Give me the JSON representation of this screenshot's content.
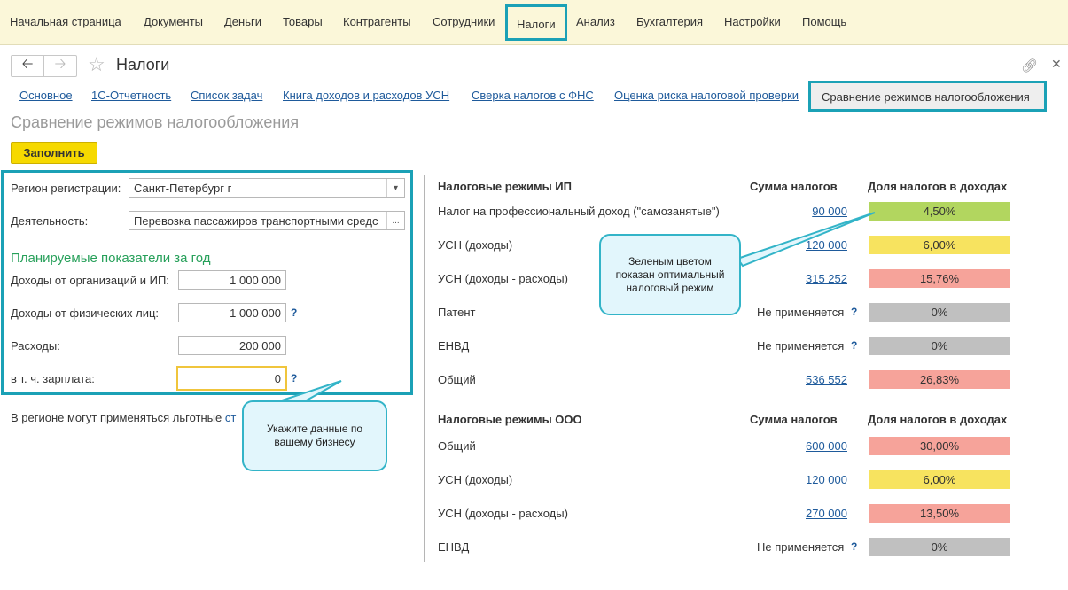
{
  "menu": {
    "items": [
      {
        "label": "Начальная страница"
      },
      {
        "label": "Документы"
      },
      {
        "label": "Деньги"
      },
      {
        "label": "Товары"
      },
      {
        "label": "Контрагенты"
      },
      {
        "label": "Сотрудники"
      },
      {
        "label": "Налоги"
      },
      {
        "label": "Анализ"
      },
      {
        "label": "Бухгалтерия"
      },
      {
        "label": "Настройки"
      },
      {
        "label": "Помощь"
      }
    ],
    "active": "Налоги"
  },
  "titlebar": {
    "back_icon": "arrow-left-icon",
    "forward_icon": "arrow-right-icon",
    "favorite_icon": "star-icon",
    "title": "Налоги",
    "link_icon": "link-icon",
    "close_icon": "close-icon"
  },
  "tabs": [
    {
      "label": "Основное"
    },
    {
      "label": "1С-Отчетность"
    },
    {
      "label": "Список задач"
    },
    {
      "label": "Книга доходов и расходов УСН"
    },
    {
      "label": "Сверка налогов с ФНС"
    },
    {
      "label": "Оценка риска налоговой проверки"
    },
    {
      "label": "Сравнение режимов налогообложения"
    }
  ],
  "section_title": "Сравнение режимов налогообложения",
  "fill_button": "Заполнить",
  "form": {
    "region_label": "Регион регистрации:",
    "region_value": "Санкт-Петербург г",
    "activity_label": "Деятельность:",
    "activity_value": "Перевозка пассажиров транспортными средс",
    "activity_button": "...",
    "group_title": "Планируемые показатели за год",
    "income_org_label": "Доходы от организаций и ИП:",
    "income_org_value": "1 000 000",
    "income_person_label": "Доходы от физических лиц:",
    "income_person_value": "1 000 000",
    "expenses_label": "Расходы:",
    "expenses_value": "200 000",
    "salary_label": "в т. ч. зарплата:",
    "salary_value": "0",
    "help": "?"
  },
  "region_note": {
    "text": "В регионе могут применяться льготные ",
    "link": "ст"
  },
  "ip": {
    "header": "Налоговые режимы ИП",
    "sum_header": "Сумма налогов",
    "share_header": "Доля налогов в доходах",
    "rows": [
      {
        "name": "Налог на профессиональный доход (\"самозанятые\")",
        "amount": "90 000",
        "share": "4,50%",
        "color": "#b2d65f"
      },
      {
        "name": "УСН (доходы)",
        "amount": "120 000",
        "share": "6,00%",
        "color": "#f7e35f"
      },
      {
        "name": "УСН (доходы - расходы)",
        "amount": "315 252",
        "share": "15,76%",
        "color": "#f6a39a"
      },
      {
        "name": "Патент",
        "amount": "Не применяется",
        "share": "0%",
        "color": "#c0c0c0"
      },
      {
        "name": "ЕНВД",
        "amount": "Не применяется",
        "share": "0%",
        "color": "#c0c0c0"
      },
      {
        "name": "Общий",
        "amount": "536 552",
        "share": "26,83%",
        "color": "#f6a39a"
      }
    ]
  },
  "ooo": {
    "header": "Налоговые режимы ООО",
    "sum_header": "Сумма налогов",
    "share_header": "Доля налогов в доходах",
    "rows": [
      {
        "name": "Общий",
        "amount": "600 000",
        "share": "30,00%",
        "color": "#f6a39a"
      },
      {
        "name": "УСН (доходы)",
        "amount": "120 000",
        "share": "6,00%",
        "color": "#f7e35f"
      },
      {
        "name": "УСН (доходы - расходы)",
        "amount": "270 000",
        "share": "13,50%",
        "color": "#f6a39a"
      },
      {
        "name": "ЕНВД",
        "amount": "Не применяется",
        "share": "0%",
        "color": "#c0c0c0"
      }
    ]
  },
  "callouts": {
    "green": "Зеленым цветом показан оптимальный налоговый режим",
    "data": "Укажите данные по вашему бизнесу"
  },
  "colors": {
    "accent": "#1ba1b6",
    "menu_bg": "#fbf7d9",
    "fill_button": "#f6d900",
    "green_title": "#27a05a",
    "link": "#1e5a9b"
  }
}
